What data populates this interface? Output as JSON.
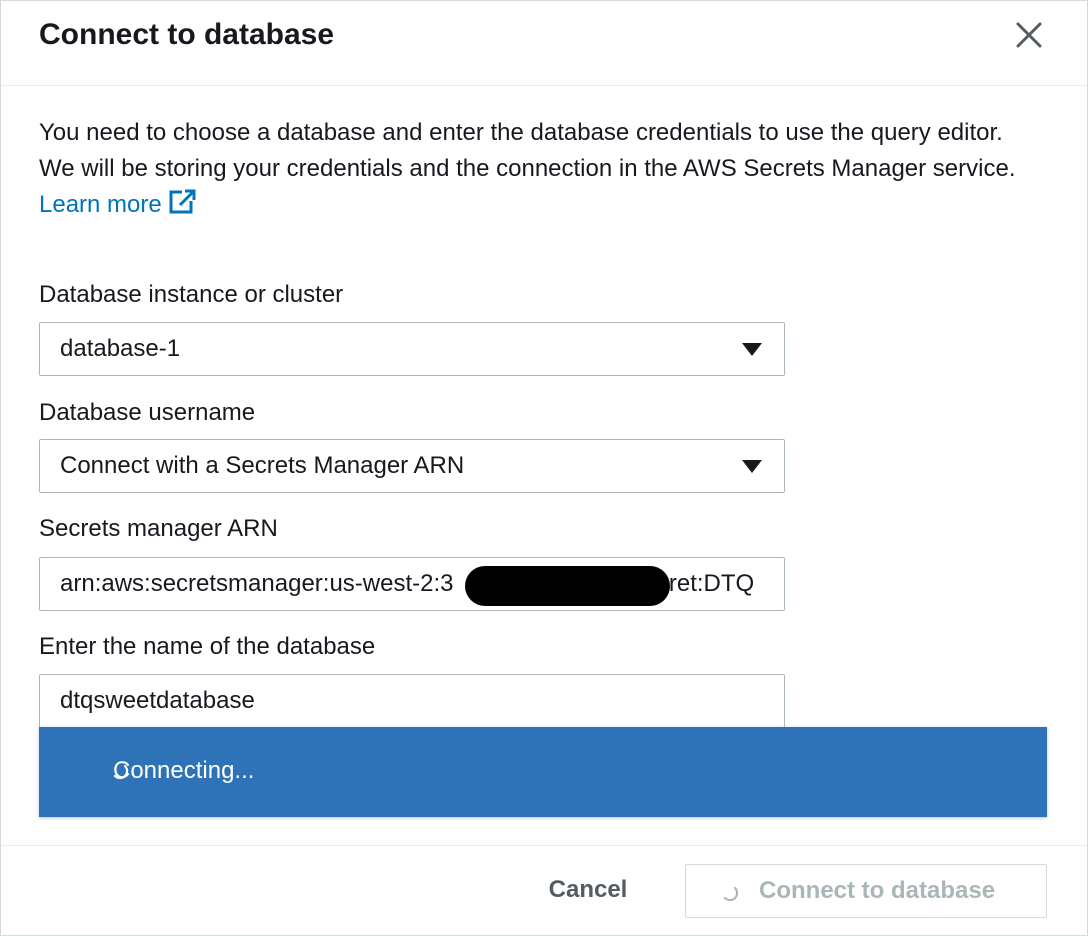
{
  "dialog": {
    "title": "Connect to database",
    "close_icon": "close-icon"
  },
  "intro": {
    "text": "You need to choose a database and enter the database credentials to use the query editor. We will be storing your credentials and the connection in the AWS Secrets Manager service. ",
    "link_label": "Learn more",
    "link_icon": "external-link-icon"
  },
  "fields": {
    "instance": {
      "label": "Database instance or cluster",
      "value": "database-1",
      "icon": "caret-down-icon"
    },
    "username": {
      "label": "Database username",
      "value": "Connect with a Secrets Manager ARN",
      "icon": "caret-down-icon"
    },
    "arn": {
      "label": "Secrets manager ARN",
      "value_prefix": "arn:aws:secretsmanager:us-west-2:3",
      "value_suffix": "7:secret:DTQ",
      "redacted": true
    },
    "database_name": {
      "label": "Enter the name of the database",
      "value": "dtqsweetdatabase"
    }
  },
  "banner": {
    "text": "Connecting...",
    "icon": "spinner-icon",
    "color": "#2e73b8"
  },
  "footer": {
    "cancel_label": "Cancel",
    "connect_label": "Connect to database",
    "connect_icon": "spinner-icon"
  },
  "colors": {
    "link": "#0073bb",
    "banner_bg": "#2e73b8",
    "disabled_text": "#aab7b8"
  }
}
